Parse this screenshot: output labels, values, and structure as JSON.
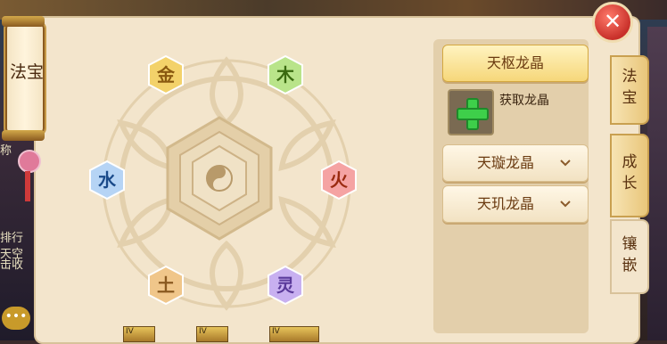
{
  "panel": {
    "title": "法宝",
    "close_label": "✕"
  },
  "background": {
    "left_texts": [
      "称",
      "排行",
      "天空",
      "击收"
    ],
    "dots": "•••"
  },
  "elements": [
    {
      "name": "metal",
      "glyph": "金",
      "color": "#f3d26a",
      "text_color": "#8a5a10"
    },
    {
      "name": "wood",
      "glyph": "木",
      "color": "#b9e48a",
      "text_color": "#3a6a10"
    },
    {
      "name": "fire",
      "glyph": "火",
      "color": "#f5a3a3",
      "text_color": "#9a2a10"
    },
    {
      "name": "earth",
      "glyph": "土",
      "color": "#f0c68a",
      "text_color": "#8a5a20"
    },
    {
      "name": "water",
      "glyph": "水",
      "color": "#b6d4f5",
      "text_color": "#1a4a8a"
    },
    {
      "name": "spirit",
      "glyph": "灵",
      "color": "#c8b0f0",
      "text_color": "#5a3a9a"
    }
  ],
  "gem_list": {
    "items": [
      {
        "label": "天枢龙晶",
        "expanded": true
      },
      {
        "label": "天璇龙晶",
        "expanded": false
      },
      {
        "label": "天玑龙晶",
        "expanded": false
      }
    ],
    "acquire_label": "获取龙晶"
  },
  "tabs": [
    {
      "label": "法宝",
      "active": false
    },
    {
      "label": "成长",
      "active": false
    },
    {
      "label": "镶嵌",
      "active": true
    }
  ],
  "badges": [
    "IV",
    "IV",
    "IV"
  ]
}
